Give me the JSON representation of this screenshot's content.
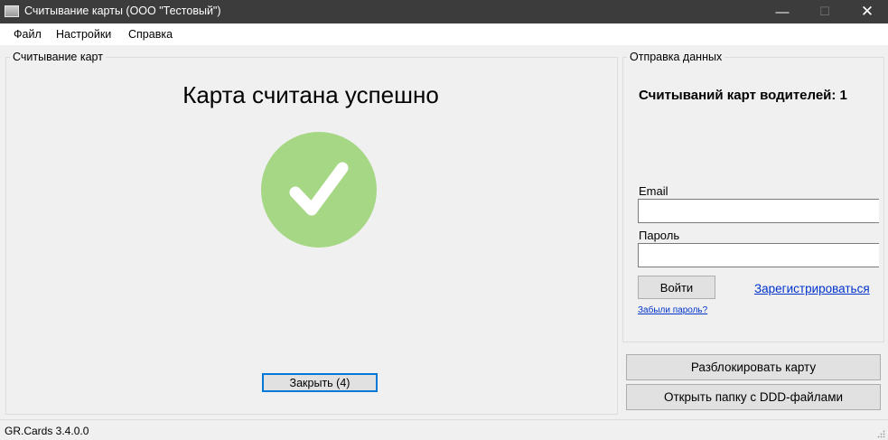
{
  "window": {
    "title": "Считывание карты (ООО \"Тестовый\")",
    "controls": {
      "minimize": "—",
      "maximize": "☐",
      "close": "✕"
    }
  },
  "menu": {
    "file": "Файл",
    "settings": "Настройки",
    "help": "Справка"
  },
  "card_reading": {
    "legend": "Считывание карт",
    "title": "Карта считана успешно",
    "status_icon": "checkmark-icon",
    "status_color": "#a6d785",
    "close_button": "Закрыть (4)"
  },
  "data_sending": {
    "legend": "Отправка данных",
    "count_text": "Считываний карт водителей: 1",
    "email_label": "Email",
    "email_value": "",
    "password_label": "Пароль",
    "password_value": "",
    "login_button": "Войти",
    "register_link": "Зарегистрироваться",
    "forgot_link": "Забыли пароль?"
  },
  "actions": {
    "unlock_card": "Разблокировать карту",
    "open_ddd_folder": "Открыть папку с DDD-файлами"
  },
  "status": {
    "version": "GR.Cards 3.4.0.0"
  }
}
